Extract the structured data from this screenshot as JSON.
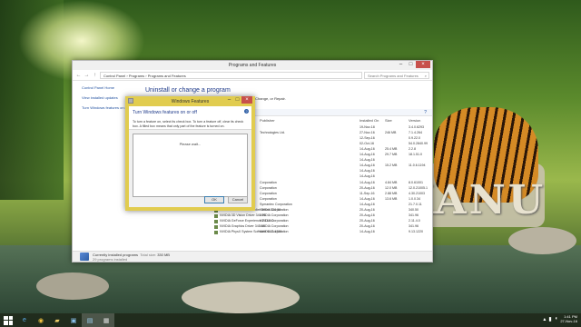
{
  "desktop": {
    "rock_text": "KANU"
  },
  "programs_window": {
    "title": "Programs and Features",
    "address_path": [
      "Control Panel",
      "Programs",
      "Programs and Features"
    ],
    "search_placeholder": "Search Programs and Features",
    "sidebar_links": [
      "Control Panel Home",
      "View installed updates",
      "Turn Windows features on or off"
    ],
    "heading": "Uninstall or change a program",
    "subtext": "To uninstall a program, select it from the list and then click Uninstall, Change, or Repair.",
    "columns": {
      "publisher": "Publisher",
      "installed_on": "Installed On",
      "size": "Size",
      "version": "Version"
    },
    "rows": [
      {
        "name": "",
        "publisher": "",
        "installed_on": "19-Nov-18",
        "size": "",
        "version": "3.4.0.6293"
      },
      {
        "name": "",
        "publisher": "Technologies Ltd.",
        "installed_on": "27-Nov-16",
        "size": "246 MB",
        "version": "7.1.4.264"
      },
      {
        "name": "",
        "publisher": "",
        "installed_on": "12-Sep-16",
        "size": "",
        "version": "0.9.22.0"
      },
      {
        "name": "",
        "publisher": "",
        "installed_on": "02-Oct-16",
        "size": "",
        "version": "54.0.2840.99"
      },
      {
        "name": "",
        "publisher": "",
        "installed_on": "14-Aug-16",
        "size": "25.4 MB",
        "version": "2.2.8"
      },
      {
        "name": "",
        "publisher": "",
        "installed_on": "14-Aug-16",
        "size": "29.7 MB",
        "version": "18.1.51.0"
      },
      {
        "name": "",
        "publisher": "",
        "installed_on": "14-Aug-16",
        "size": "",
        "version": ""
      },
      {
        "name": "",
        "publisher": "",
        "installed_on": "14-Aug-16",
        "size": "15.2 MB",
        "version": "11.0.6.1194"
      },
      {
        "name": "",
        "publisher": "",
        "installed_on": "14-Aug-16",
        "size": "",
        "version": ""
      },
      {
        "name": "",
        "publisher": "",
        "installed_on": "14-Aug-16",
        "size": "",
        "version": ""
      },
      {
        "name": "",
        "publisher": "Corporation",
        "installed_on": "14-Aug-16",
        "size": "4.84 MB",
        "version": "8.0.61001"
      },
      {
        "name": "",
        "publisher": "Corporation",
        "installed_on": "20-Aug-16",
        "size": "12.0 MB",
        "version": "12.0.21005.1"
      },
      {
        "name": "",
        "publisher": "Corporation",
        "installed_on": "11-Sep-16",
        "size": "2.88 MB",
        "version": "4.30.21003"
      },
      {
        "name": "",
        "publisher": "Corporation",
        "installed_on": "14-Aug-16",
        "size": "13.6 MB",
        "version": "1.0.0.34"
      },
      {
        "name": "Norton Internet Security",
        "publisher": "Symantec Corporation",
        "installed_on": "14-Aug-16",
        "size": "",
        "version": "21.7.0.11"
      },
      {
        "name": "NVIDIA 3D Vision Controller Driver 340.50",
        "publisher": "NVIDIA Corporation",
        "installed_on": "20-Aug-16",
        "size": "",
        "version": "340.50"
      },
      {
        "name": "NVIDIA 3D Vision Driver 341.96",
        "publisher": "NVIDIA Corporation",
        "installed_on": "20-Aug-16",
        "size": "",
        "version": "341.96"
      },
      {
        "name": "NVIDIA GeForce Experience 2.11.4.0",
        "publisher": "NVIDIA Corporation",
        "installed_on": "20-Aug-16",
        "size": "",
        "version": "2.11.4.0"
      },
      {
        "name": "NVIDIA Graphics Driver 341.96",
        "publisher": "NVIDIA Corporation",
        "installed_on": "20-Aug-16",
        "size": "",
        "version": "341.96"
      },
      {
        "name": "NVIDIA PhysX System Software 9.13.1220",
        "publisher": "NVIDIA Corporation",
        "installed_on": "14-Aug-16",
        "size": "",
        "version": "9.13.1220"
      }
    ],
    "status": {
      "label": "Currently installed programs",
      "total_size_label": "Total size:",
      "total_size": "330 MB",
      "count_text": "29 programs installed"
    }
  },
  "windows_features_dialog": {
    "title": "Windows Features",
    "heading": "Turn Windows features on or off",
    "instructions": "To turn a feature on, select its check box. To turn a feature off, clear its check box. A filled box means that only part of the feature is turned on.",
    "loading_text": "Please wait...",
    "ok_label": "OK",
    "cancel_label": "Cancel"
  },
  "taskbar": {
    "apps": [
      "ie-icon",
      "chrome-icon",
      "file-explorer-icon",
      "store-icon",
      "control-panel-icon",
      "windows-features-icon"
    ],
    "time": "1:41 PM",
    "date": "27-Nov-16"
  }
}
